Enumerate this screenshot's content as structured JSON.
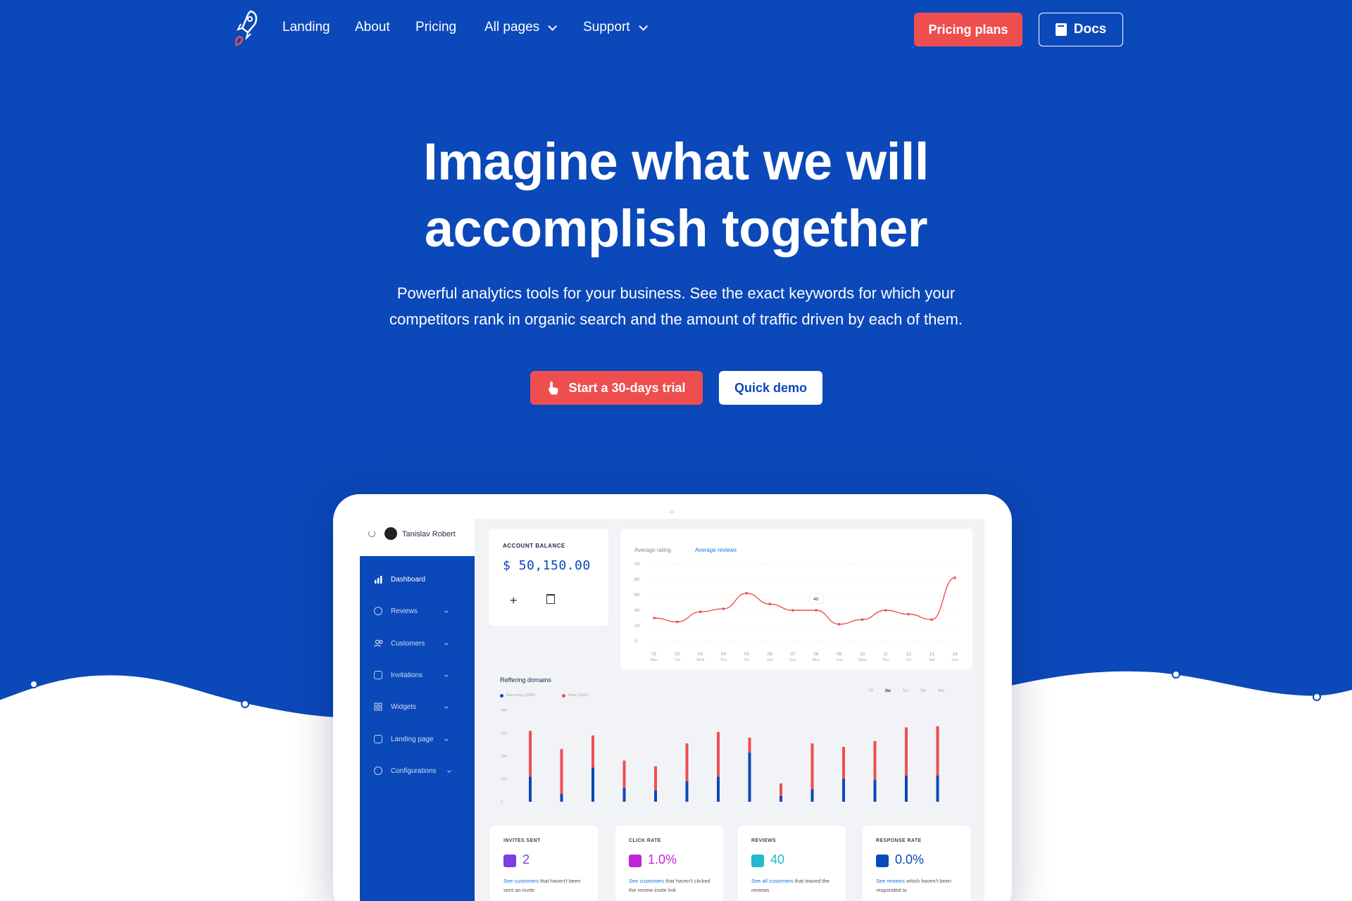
{
  "nav": {
    "links": [
      "Landing",
      "About",
      "Pricing",
      "All pages",
      "Support"
    ],
    "pricing_button": "Pricing plans",
    "docs_button": "Docs"
  },
  "hero": {
    "title_line1": "Imagine what we will",
    "title_line2": "accomplish together",
    "subtitle_line1": "Powerful analytics tools for your business. See the exact keywords for which your",
    "subtitle_line2": "competitors rank in organic search and the amount of traffic driven by each of them.",
    "trial_button": "Start a 30-days trial",
    "demo_button": "Quick demo"
  },
  "colors": {
    "brand_blue": "#0b48b9",
    "accent_red": "#ef4e4f"
  },
  "dashboard": {
    "user_name": "Tanislav Robert",
    "sidebar": [
      {
        "label": "Dashboard",
        "icon": "bar-chart-icon"
      },
      {
        "label": "Reviews",
        "icon": "star-circle-icon"
      },
      {
        "label": "Customers",
        "icon": "users-icon"
      },
      {
        "label": "Invitations",
        "icon": "envelope-icon"
      },
      {
        "label": "Widgets",
        "icon": "widgets-icon"
      },
      {
        "label": "Landing page",
        "icon": "page-icon"
      },
      {
        "label": "Configurations",
        "icon": "gear-icon"
      }
    ],
    "balance": {
      "title": "ACCOUNT BALANCE",
      "value": "$ 50,150.00"
    },
    "rating_tabs": [
      "Average rating",
      "Average reviews"
    ],
    "referring_title": "Reffering domains",
    "referring_legend": [
      "Recurring (2840)",
      "New (1180)"
    ],
    "referring_ranges": [
      "7d",
      "2w",
      "1m",
      "3m",
      "6m"
    ],
    "stats": [
      {
        "title": "INVITES SENT",
        "value": "2",
        "link": "See customers",
        "desc": " that haven't been sent an invite",
        "color": "#7b3fe4"
      },
      {
        "title": "CLICK RATE",
        "value": "1.0%",
        "link": "See customers",
        "desc": " that haven't clicked the review invite link",
        "color": "#c026d3"
      },
      {
        "title": "REVIEWS",
        "value": "40",
        "link": "See all customers",
        "desc": " that leaved the reviews",
        "color": "#22b8cf"
      },
      {
        "title": "RESPONSE RATE",
        "value": "0.0%",
        "link": "See reviews",
        "desc": " which haven't been responded to",
        "color": "#0b48b9"
      }
    ]
  },
  "chart_data": [
    {
      "type": "line",
      "title": "Average reviews",
      "x": [
        "01",
        "02",
        "03",
        "04",
        "05",
        "06",
        "07",
        "08",
        "09",
        "10",
        "11",
        "12",
        "13",
        "14"
      ],
      "x_sub": [
        "Mon",
        "Tue",
        "Wed",
        "Thu",
        "Fri",
        "Sat",
        "Sun",
        "Mon",
        "Tue",
        "Wed",
        "Thu",
        "Fri",
        "Sat",
        "Sun"
      ],
      "values": [
        30,
        25,
        38,
        42,
        62,
        48,
        40,
        40,
        22,
        28,
        40,
        35,
        28,
        82
      ],
      "ylim": [
        0,
        100
      ],
      "yticks": [
        "0",
        "20",
        "40",
        "60",
        "80",
        "10"
      ],
      "annotation": "40",
      "color": "#ef4e4f"
    },
    {
      "type": "bar",
      "title": "Reffering domains",
      "yticks": [
        "0",
        "100",
        "200",
        "300",
        "400"
      ],
      "ylim": [
        0,
        400
      ],
      "series": [
        {
          "name": "Recurring (2840)",
          "color": "#0b48b9",
          "values": [
            110,
            35,
            150,
            60,
            50,
            90,
            110,
            215,
            25,
            55,
            100,
            95,
            115,
            115
          ]
        },
        {
          "name": "New (1180)",
          "color": "#ef4e4f",
          "values": [
            200,
            195,
            140,
            120,
            105,
            165,
            195,
            65,
            55,
            200,
            140,
            170,
            210,
            215
          ]
        }
      ]
    }
  ]
}
